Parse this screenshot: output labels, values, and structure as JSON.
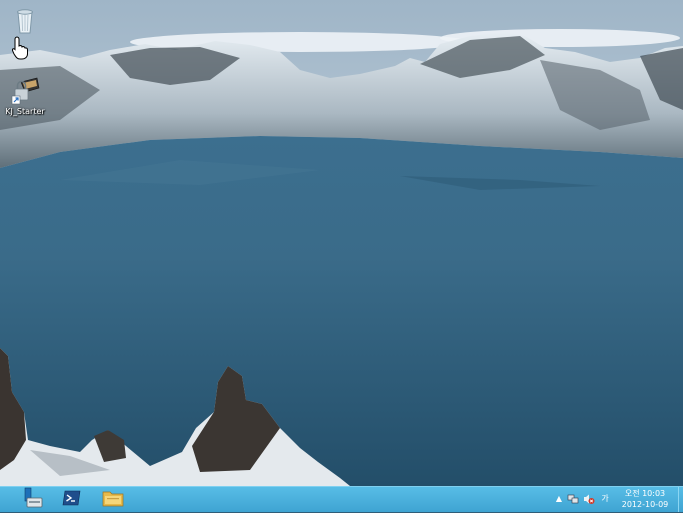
{
  "desktop": {
    "icons": [
      {
        "label": "",
        "icon": "recycle-bin-icon"
      },
      {
        "label": "KJ_Starter",
        "icon": "lock-shortcut-icon"
      }
    ]
  },
  "taskbar": {
    "pinned": [
      {
        "icon": "server-manager-icon"
      },
      {
        "icon": "powershell-icon"
      },
      {
        "icon": "file-explorer-icon"
      }
    ],
    "tray": {
      "chevron": "▲",
      "ime_label": "가",
      "clock": {
        "time": "오전 10:03",
        "date": "2012-10-09"
      }
    }
  },
  "colors": {
    "taskbar": "#4ab0dc",
    "lake": "#2f5d78",
    "sky": "#c9d7e2"
  }
}
